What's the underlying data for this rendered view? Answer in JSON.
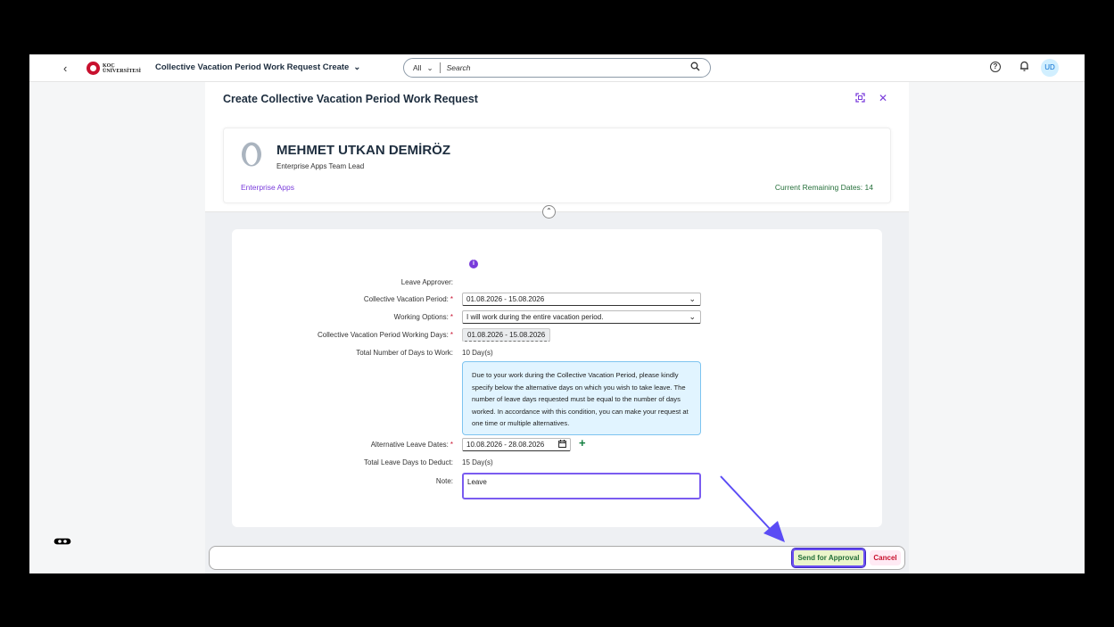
{
  "shell": {
    "back_icon": "chevron-left-icon",
    "logo_text_line1": "KOÇ",
    "logo_text_line2": "ÜNİVERSİTESİ",
    "app_title": "Collective Vacation Period Work Request Create",
    "search_scope": "All",
    "search_placeholder": "Search",
    "avatar_initials": "UD"
  },
  "dialog": {
    "title": "Create Collective Vacation Period Work Request",
    "employee": {
      "name": "MEHMET UTKAN DEMİRÖZ",
      "role": "Enterprise Apps Team Lead",
      "department": "Enterprise Apps",
      "remaining": "Current Remaining Dates: 14"
    },
    "form": {
      "leave_approver_label": "Leave Approver:",
      "period_label": "Collective Vacation Period:",
      "period_value": "01.08.2026 - 15.08.2026",
      "working_options_label": "Working Options:",
      "working_options_value": "I will work during the entire vacation period.",
      "working_days_label": "Collective Vacation Period Working Days:",
      "working_days_value": "01.08.2026 - 15.08.2026",
      "total_days_label": "Total Number of Days to Work:",
      "total_days_value": "10 Day(s)",
      "notice": "Due to your work during the Collective Vacation Period, please kindly specify below the alternative days on which you wish to take leave. The number of leave days requested must be equal to the number of days worked. In accordance with this condition, you can make your request at one time or multiple alternatives.",
      "alt_dates_label": "Alternative Leave Dates:",
      "alt_dates_value": "10.08.2026 - 28.08.2026",
      "deduct_label": "Total Leave Days to Deduct:",
      "deduct_value": "15 Day(s)",
      "note_label": "Note:",
      "note_value": "Leave"
    },
    "footer": {
      "approve_label": "Send for Approval",
      "cancel_label": "Cancel"
    }
  },
  "colors": {
    "accent": "#7a3cdb",
    "success": "#256f3a",
    "danger": "#c8102e",
    "annotation_arrow": "#5b4cf5"
  }
}
